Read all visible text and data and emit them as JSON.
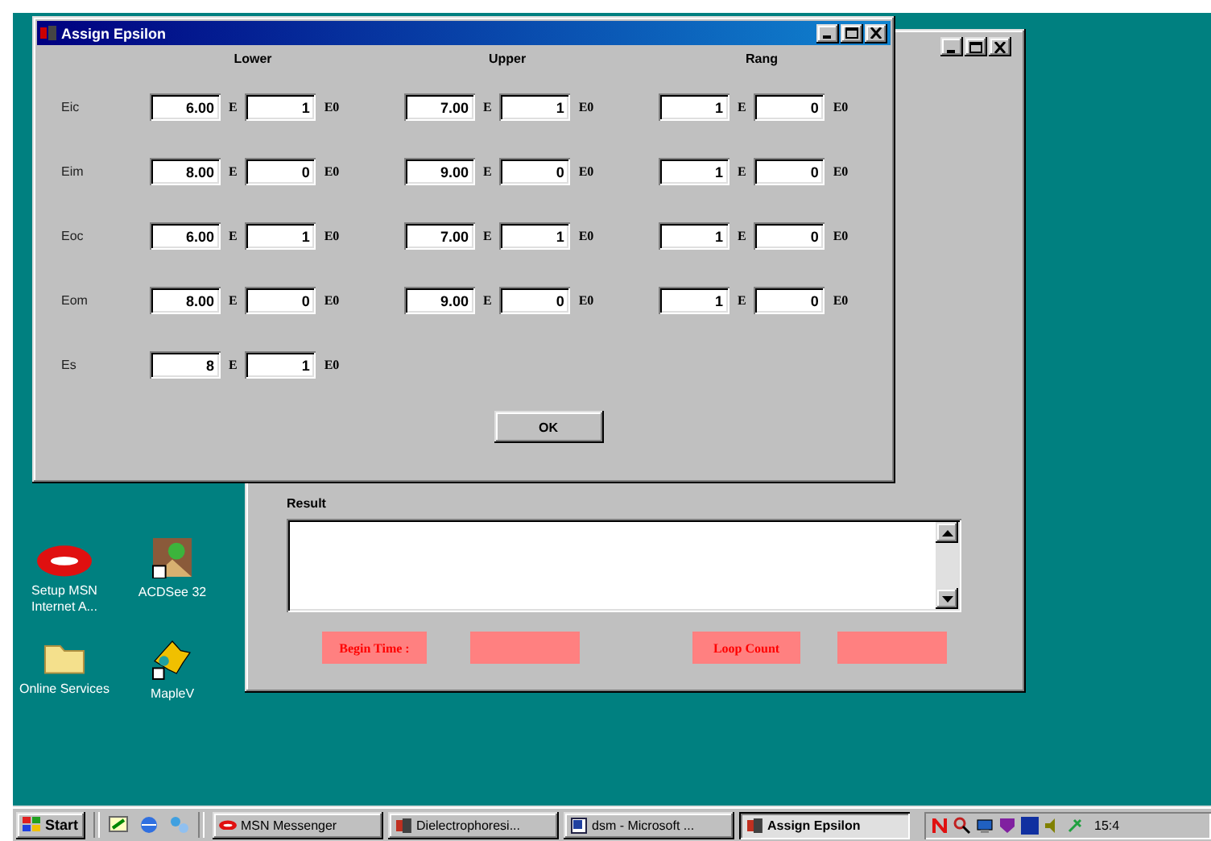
{
  "dialog": {
    "title": "Assign Epsilon",
    "columns": [
      "Lower",
      "Upper",
      "Rang"
    ],
    "rows": [
      {
        "label": "Eic",
        "groups": [
          {
            "value": "6.00",
            "e": "E",
            "exponent": "1",
            "unit": "E0"
          },
          {
            "value": "7.00",
            "e": "E",
            "exponent": "1",
            "unit": "E0"
          },
          {
            "value": "1",
            "e": "E",
            "exponent": "0",
            "unit": "E0"
          }
        ]
      },
      {
        "label": "Eim",
        "groups": [
          {
            "value": "8.00",
            "e": "E",
            "exponent": "0",
            "unit": "E0"
          },
          {
            "value": "9.00",
            "e": "E",
            "exponent": "0",
            "unit": "E0"
          },
          {
            "value": "1",
            "e": "E",
            "exponent": "0",
            "unit": "E0"
          }
        ]
      },
      {
        "label": "Eoc",
        "groups": [
          {
            "value": "6.00",
            "e": "E",
            "exponent": "1",
            "unit": "E0"
          },
          {
            "value": "7.00",
            "e": "E",
            "exponent": "1",
            "unit": "E0"
          },
          {
            "value": "1",
            "e": "E",
            "exponent": "0",
            "unit": "E0"
          }
        ]
      },
      {
        "label": "Eom",
        "groups": [
          {
            "value": "8.00",
            "e": "E",
            "exponent": "0",
            "unit": "E0"
          },
          {
            "value": "9.00",
            "e": "E",
            "exponent": "0",
            "unit": "E0"
          },
          {
            "value": "1",
            "e": "E",
            "exponent": "0",
            "unit": "E0"
          }
        ]
      },
      {
        "label": "Es",
        "groups": [
          {
            "value": "8",
            "e": "E",
            "exponent": "1",
            "unit": "E0"
          }
        ]
      }
    ],
    "ok": "OK"
  },
  "main_window": {
    "result_label": "Result",
    "begin_time_label": "Begin Time :",
    "loop_count_label": "Loop Count"
  },
  "desktop_icons": [
    {
      "label": "Setup MSN Internet A...",
      "kind": "msn"
    },
    {
      "label": "ACDSee 32",
      "kind": "viewer"
    },
    {
      "label": "Online Services",
      "kind": "folder"
    },
    {
      "label": "MapleV",
      "kind": "maple"
    }
  ],
  "taskbar": {
    "start": "Start",
    "tasks": [
      {
        "label": "MSN Messenger",
        "kind": "msn",
        "selected": false
      },
      {
        "label": "Dielectrophoresi...",
        "kind": "app",
        "selected": false
      },
      {
        "label": "dsm - Microsoft ...",
        "kind": "word",
        "selected": false
      },
      {
        "label": "Assign Epsilon",
        "kind": "app",
        "selected": true
      }
    ],
    "clock": "15:4"
  }
}
